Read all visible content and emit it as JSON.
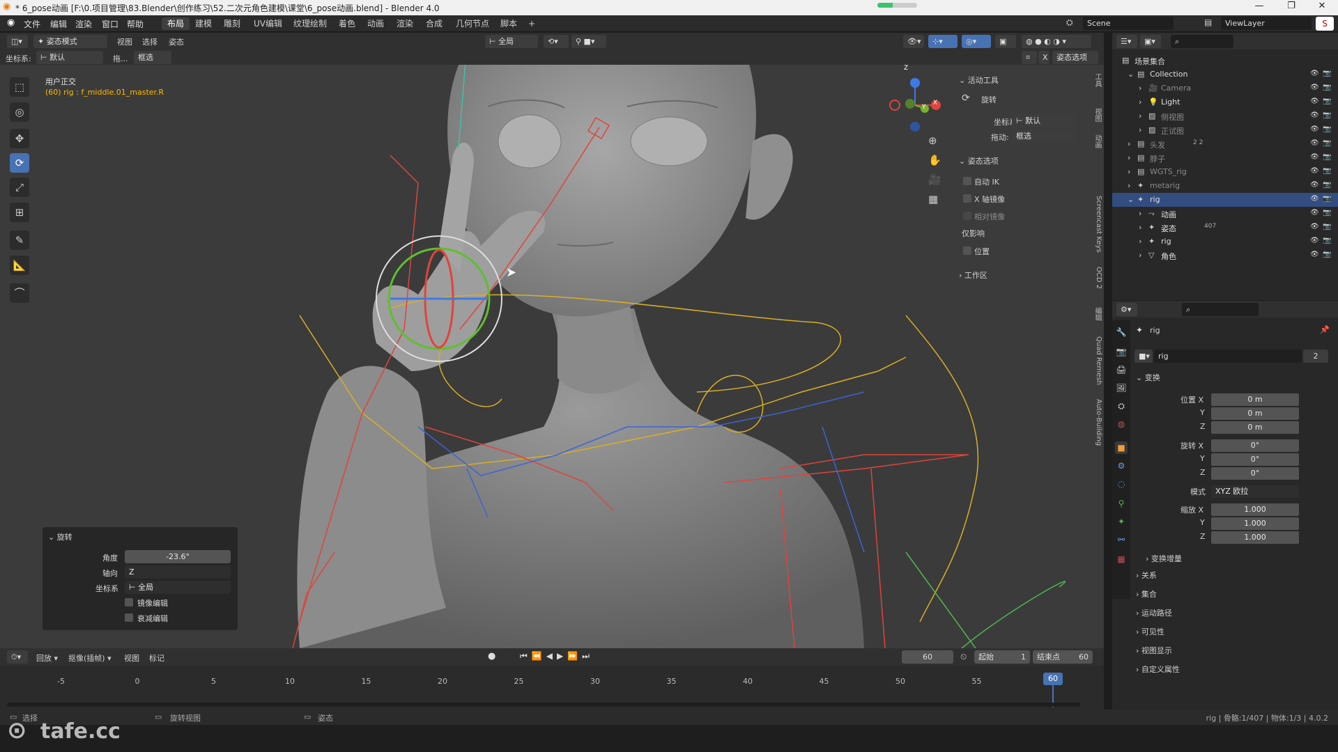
{
  "titlebar": {
    "title": "* 6_pose动画 [F:\\0.项目管理\\83.Blender\\创作练习\\52.二次元角色建模\\课堂\\6_pose动画.blend] - Blender 4.0",
    "progress": 0.38,
    "minimize": "—",
    "maximize": "❐",
    "close": "✕"
  },
  "menubar": {
    "items": [
      "文件",
      "编辑",
      "渲染",
      "窗口",
      "帮助"
    ],
    "tabs": [
      "布局",
      "建模",
      "雕刻",
      "UV编辑",
      "纹理绘制",
      "着色",
      "动画",
      "渲染",
      "合成",
      "几何节点",
      "脚本"
    ],
    "active_tab": 0,
    "add_tab": "+",
    "scene": "Scene",
    "viewlayer": "ViewLayer"
  },
  "viewport_header": {
    "mode": "姿态模式",
    "menus": [
      "视图",
      "选择",
      "姿态"
    ],
    "transform_orientation": "全局",
    "pose_options": "姿态选项",
    "coord_label": "坐标系:",
    "coord_value": "默认",
    "drag_label": "拖...",
    "drag_value": "框选",
    "x_btn": "X"
  },
  "viewport": {
    "view_name": "用户正交",
    "active_bone": "(60) rig : f_middle.01_master.R",
    "gizmo_axes": [
      "X",
      "Y",
      "Z"
    ]
  },
  "npanel": {
    "active_tool_title": "活动工具",
    "tool_name": "旋转",
    "coord_label": "坐标系",
    "coord_value": "默认",
    "drag_label": "拖动:",
    "drag_value": "框选",
    "pose_options_title": "姿态选项",
    "auto_ik": "自动 IK",
    "x_mirror": "X 轴镜像",
    "relative_mirror": "相对镜像",
    "affect_only": "仅影响",
    "location": "位置",
    "workspace": "工作区",
    "tabs": [
      "工具",
      "视图",
      "动画",
      "Screencast Keys",
      "OCD 2",
      "编辑",
      "Quad Remesh",
      "Auto-Building"
    ]
  },
  "operator_panel": {
    "title": "旋转",
    "angle_label": "角度",
    "angle_value": "-23.6°",
    "axis_label": "轴向",
    "axis_value": "Z",
    "orient_label": "坐标系",
    "orient_value": "全局",
    "mirror_edit": "镜像编辑",
    "proportional_edit": "衰减编辑"
  },
  "outliner": {
    "root": "场景集合",
    "rows": [
      {
        "name": "Collection",
        "level": 1,
        "expanded": true
      },
      {
        "name": "Camera",
        "level": 2,
        "dim": true
      },
      {
        "name": "Light",
        "level": 2,
        "dim": false
      },
      {
        "name": "侧视图",
        "level": 2,
        "dim": true
      },
      {
        "name": "正试图",
        "level": 2,
        "dim": true
      },
      {
        "name": "头发",
        "level": 1,
        "dim": true,
        "badge": "2  2"
      },
      {
        "name": "脖子",
        "level": 1,
        "dim": true
      },
      {
        "name": "WGTS_rig",
        "level": 1,
        "dim": true
      },
      {
        "name": "metarig",
        "level": 1,
        "dim": true
      },
      {
        "name": "rig",
        "level": 1,
        "selected": true
      },
      {
        "name": "动画",
        "level": 2
      },
      {
        "name": "姿态",
        "level": 2,
        "badge": "407"
      },
      {
        "name": "rig",
        "level": 2
      },
      {
        "name": "角色",
        "level": 2
      }
    ]
  },
  "properties": {
    "object_name": "rig",
    "datablock_name": "rig",
    "users": "2",
    "transform_title": "变换",
    "location_label": "位置 X",
    "location": [
      "0 m",
      "0 m",
      "0 m"
    ],
    "rotation_label": "旋转 X",
    "rotation": [
      "0°",
      "0°",
      "0°"
    ],
    "mode_label": "模式",
    "mode_value": "XYZ 欧拉",
    "scale_label": "缩放 X",
    "scale": [
      "1.000",
      "1.000",
      "1.000"
    ],
    "axis_y": "Y",
    "axis_z": "Z",
    "delta": "变换增量",
    "sections": [
      "关系",
      "集合",
      "运动路径",
      "可见性",
      "视图显示",
      "自定义属性"
    ]
  },
  "timeline": {
    "menus": [
      "回放",
      "抠像(插帧)",
      "视图",
      "标记"
    ],
    "current_frame": "60",
    "start_label": "起始",
    "start": "1",
    "end_label": "结束点",
    "end": "60",
    "ticks": [
      "-5",
      "0",
      "5",
      "10",
      "15",
      "20",
      "25",
      "30",
      "35",
      "40",
      "45",
      "50",
      "55",
      "60"
    ],
    "playhead": "60"
  },
  "statusbar": {
    "select": "选择",
    "rotate_view": "旋转视图",
    "pose": "姿态",
    "stats": "rig | 骨骼:1/407 | 物体:1/3 | 4.0.2"
  },
  "watermark": "tafe.cc",
  "colors": {
    "accent": "#4772b3",
    "active_bone": "#ffb900",
    "selected_row": "#334d80",
    "bone_red": "#e0443a",
    "bone_yellow": "#d8b024",
    "bone_blue": "#3d63d6",
    "bone_green": "#4fb84d"
  }
}
